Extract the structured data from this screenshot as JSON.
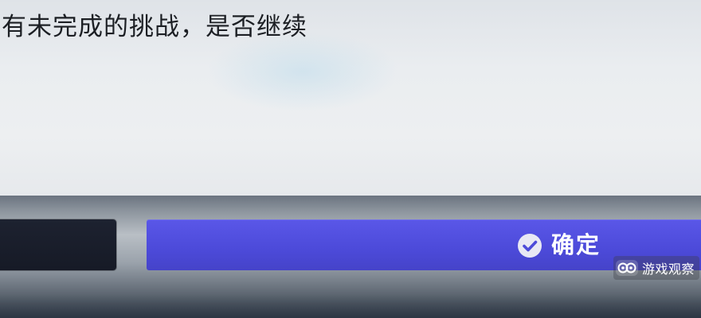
{
  "dialog": {
    "message": "有未完成的挑战，是否继续"
  },
  "buttons": {
    "confirm_label": "确定",
    "confirm_icon": "check-circle-icon",
    "cancel_label": ""
  },
  "watermark": {
    "text": "游戏观察",
    "logo_icon": "infinity-eyes-logo"
  },
  "colors": {
    "confirm_button": "#4c4ad9",
    "cancel_button": "#1a1e2b",
    "dialog_background": "#eaedf0",
    "message_text": "#1c1f24"
  }
}
